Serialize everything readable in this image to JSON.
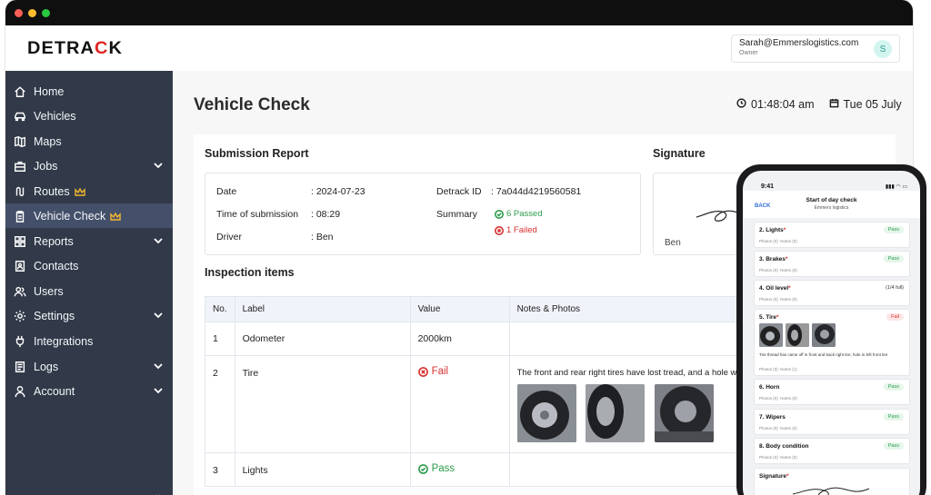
{
  "brand": {
    "logo_left": "DETRA",
    "logo_mid": "C",
    "logo_right": "K"
  },
  "user": {
    "email": "Sarah@Emmerslogistics.com",
    "role": "Owner",
    "initial": "S"
  },
  "sidebar": {
    "items": [
      {
        "label": "Home",
        "icon": "home-icon"
      },
      {
        "label": "Vehicles",
        "icon": "car-icon"
      },
      {
        "label": "Maps",
        "icon": "map-icon"
      },
      {
        "label": "Jobs",
        "icon": "briefcase-icon",
        "expandable": true
      },
      {
        "label": "Routes",
        "icon": "route-icon",
        "premium": true
      },
      {
        "label": "Vehicle Check",
        "icon": "clipboard-icon",
        "premium": true,
        "active": true
      },
      {
        "label": "Reports",
        "icon": "grid-icon",
        "expandable": true
      },
      {
        "label": "Contacts",
        "icon": "contact-icon"
      },
      {
        "label": "Users",
        "icon": "users-icon"
      },
      {
        "label": "Settings",
        "icon": "gear-icon",
        "expandable": true
      },
      {
        "label": "Integrations",
        "icon": "plug-icon"
      },
      {
        "label": "Logs",
        "icon": "log-icon",
        "expandable": true
      },
      {
        "label": "Account",
        "icon": "user-icon",
        "expandable": true
      }
    ],
    "collapse_glyph": "«"
  },
  "page": {
    "title": "Vehicle Check",
    "time": "01:48:04 am",
    "date": "Tue 05 July"
  },
  "report": {
    "title": "Submission Report",
    "date_label": "Date",
    "date_value": ": 2024-07-23",
    "time_label": "Time of submission",
    "time_value": ": 08:29",
    "driver_label": "Driver",
    "driver_value": ": Ben",
    "id_label": "Detrack ID",
    "id_value": ": 7a044d4219560581",
    "summary_label": "Summary",
    "passed": "6 Passed",
    "failed": "1 Failed"
  },
  "signature": {
    "title": "Signature",
    "name": "Ben"
  },
  "inspection": {
    "title": "Inspection items",
    "columns": [
      "No.",
      "Label",
      "Value",
      "Notes & Photos"
    ],
    "rows": [
      {
        "no": "1",
        "label": "Odometer",
        "value": "2000km",
        "notes": ""
      },
      {
        "no": "2",
        "label": "Tire",
        "value": "Fail",
        "notes": "The front and rear right tires have lost tread, and a hole wa"
      },
      {
        "no": "3",
        "label": "Lights",
        "value": "Pass",
        "notes": ""
      }
    ]
  },
  "phone": {
    "time": "9:41",
    "back": "BACK",
    "title": "Start of day check",
    "subtitle": "Emmers logistics",
    "items": [
      {
        "label": "2. Lights",
        "status": "Pass",
        "photos": "Photos (0)",
        "notes": "Notes (0)"
      },
      {
        "label": "3. Brakes",
        "status": "Pass",
        "photos": "Photos (0)",
        "notes": "Notes (0)"
      },
      {
        "label": "4. Oil level",
        "status": "(1/4 full)",
        "photos": "Photos (0)",
        "notes": "Notes (0)"
      },
      {
        "label": "5. Tire",
        "status": "Fail",
        "photos": "Photos (3)",
        "notes": "Notes (1)",
        "note_text": "Tire thread has came off in front and back right tire, hole in left front tire"
      },
      {
        "label": "6. Horn",
        "status": "Pass",
        "photos": "Photos (0)",
        "notes": "Notes (0)"
      },
      {
        "label": "7. Wipers",
        "status": "Pass",
        "photos": "Photos (0)",
        "notes": "Notes (0)"
      },
      {
        "label": "8. Body condition",
        "status": "Pass",
        "photos": "Photos (0)",
        "notes": "Notes (0)"
      }
    ],
    "signature_label": "Signature"
  },
  "colors": {
    "sidebar": "#323a49",
    "active": "#44506a",
    "pass": "#2e9d4c",
    "fail": "#d93030",
    "brand_red": "#e02424"
  }
}
